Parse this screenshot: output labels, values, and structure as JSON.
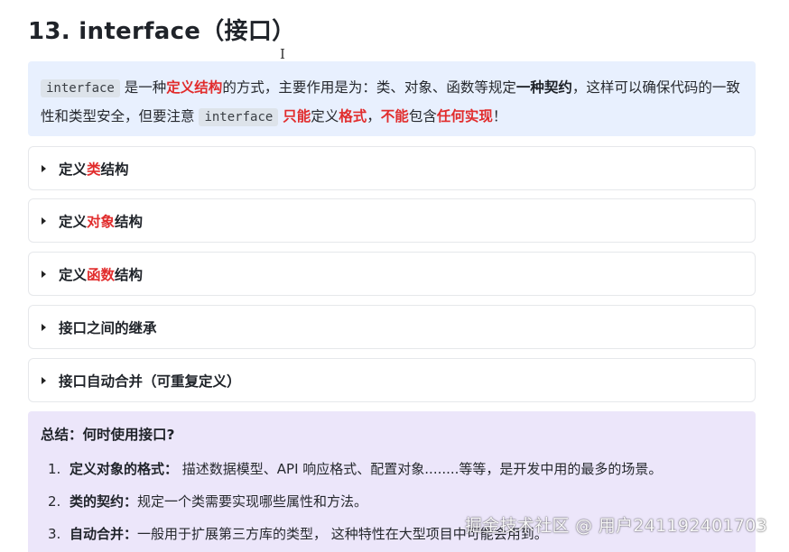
{
  "heading": "13. interface（接口）",
  "cursor_glyph": "I",
  "intro": {
    "code_word": "interface",
    "p1": " 是一种",
    "em1": "定义结构",
    "p2": "的方式，主要作用是为：类、对象、函数等规定",
    "strong1": "一种契约",
    "p3": "，这样可以确保代码的一致性和类型安全，但要注意 ",
    "code_word2": "interface",
    "em2": "只能",
    "p4": "定义",
    "em3": "格式",
    "p5": "，",
    "em4": "不能",
    "p6": "包含",
    "em5": "任何实现",
    "p7": "！"
  },
  "sections": [
    {
      "pre": "定义",
      "hl": "类",
      "post": "结构"
    },
    {
      "pre": "定义",
      "hl": "对象",
      "post": "结构"
    },
    {
      "pre": "定义",
      "hl": "函数",
      "post": "结构"
    },
    {
      "pre": "接口之间的继承",
      "hl": "",
      "post": ""
    },
    {
      "pre": "接口自动合并（可重复定义）",
      "hl": "",
      "post": ""
    }
  ],
  "summary": {
    "title": "总结：何时使用接口?",
    "items": [
      {
        "num": "1.",
        "label": "定义对象的格式：",
        "text": " 描述数据模型、API 响应格式、配置对象........等等，是开发中用的最多的场景。"
      },
      {
        "num": "2.",
        "label": "类的契约：",
        "text": "规定一个类需要实现哪些属性和方法。"
      },
      {
        "num": "3.",
        "label": "自动合并：",
        "text": "一般用于扩展第三方库的类型， 这种特性在大型项目中可能会用到。"
      }
    ]
  },
  "watermark": "掘金技术社区 @ 用户241192401703",
  "colors": {
    "emphasis": "#e12c2c",
    "callout_bg": "#e8f0fe",
    "summary_bg": "#ece6fa"
  }
}
